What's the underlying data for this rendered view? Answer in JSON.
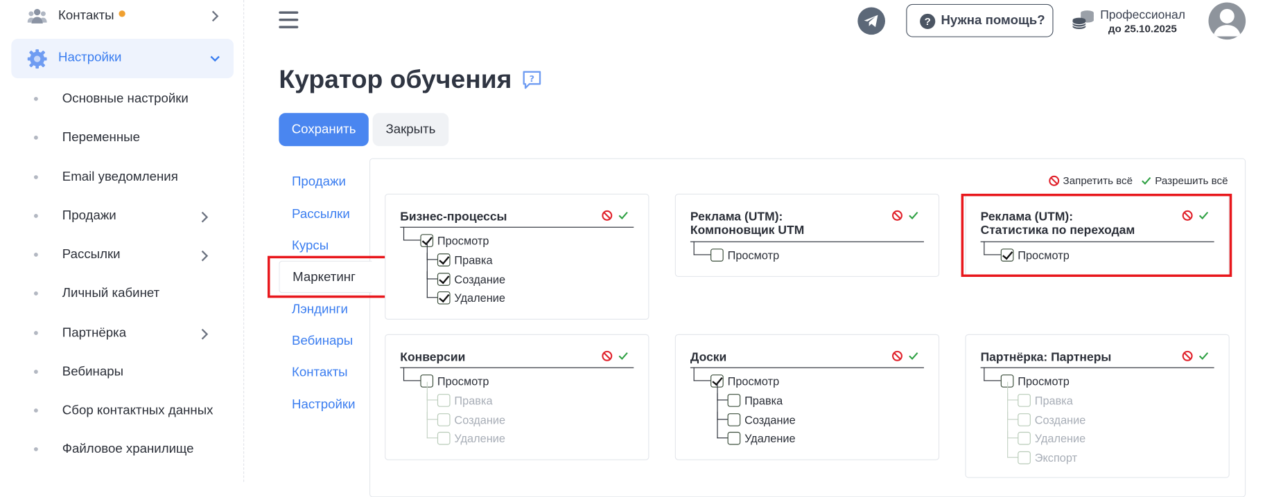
{
  "sidebar": {
    "top_item": "Контакты",
    "active_item": "Настройки",
    "sub_items": [
      {
        "label": "Основные настройки",
        "chevron": false
      },
      {
        "label": "Переменные",
        "chevron": false
      },
      {
        "label": "Email уведомления",
        "chevron": false
      },
      {
        "label": "Продажи",
        "chevron": true
      },
      {
        "label": "Рассылки",
        "chevron": true
      },
      {
        "label": "Личный кабинет",
        "chevron": false
      },
      {
        "label": "Партнёрка",
        "chevron": true
      },
      {
        "label": "Вебинары",
        "chevron": false
      },
      {
        "label": "Сбор контактных данных",
        "chevron": false
      },
      {
        "label": "Файловое хранилище",
        "chevron": false
      }
    ]
  },
  "header": {
    "help_label": "Нужна помощь?",
    "plan_name": "Профессионал",
    "plan_until": "до 25.10.2025"
  },
  "page": {
    "title": "Куратор обучения",
    "save_label": "Сохранить",
    "close_label": "Закрыть"
  },
  "tabs": [
    "Продажи",
    "Рассылки",
    "Курсы",
    "Маркетинг",
    "Лэндинги",
    "Вебинары",
    "Контакты",
    "Настройки"
  ],
  "active_tab": "Маркетинг",
  "global_actions": {
    "deny_all": "Запретить всё",
    "allow_all": "Разрешить всё"
  },
  "cards": [
    {
      "title": "Бизнес-процессы",
      "view": "Просмотр",
      "view_checked": true,
      "children": [
        {
          "label": "Правка",
          "checked": true
        },
        {
          "label": "Создание",
          "checked": true
        },
        {
          "label": "Удаление",
          "checked": true
        }
      ]
    },
    {
      "title_line1": "Реклама (UTM):",
      "title_line2": "Компоновщик UTM",
      "view": "Просмотр",
      "view_checked": false
    },
    {
      "title_line1": "Реклама (UTM):",
      "title_line2": "Статистика по переходам",
      "view": "Просмотр",
      "view_checked": true
    },
    {
      "title": "Конверсии",
      "view": "Просмотр",
      "view_checked": false,
      "children": [
        {
          "label": "Правка",
          "disabled": true
        },
        {
          "label": "Создание",
          "disabled": true
        },
        {
          "label": "Удаление",
          "disabled": true
        }
      ]
    },
    {
      "title": "Доски",
      "view": "Просмотр",
      "view_checked": true,
      "children": [
        {
          "label": "Правка",
          "checked": false
        },
        {
          "label": "Создание",
          "checked": false
        },
        {
          "label": "Удаление",
          "checked": false
        }
      ]
    },
    {
      "title": "Партнёрка: Партнеры",
      "view": "Просмотр",
      "view_checked": false,
      "children": [
        {
          "label": "Правка",
          "disabled": true
        },
        {
          "label": "Создание",
          "disabled": true
        },
        {
          "label": "Удаление",
          "disabled": true
        },
        {
          "label": "Экспорт",
          "disabled": true
        }
      ]
    }
  ],
  "colors": {
    "accent": "#3a7df0",
    "save_button": "#4a86f0",
    "highlight": "#e8171c",
    "deny": "#e0202a",
    "allow": "#2ea043"
  }
}
